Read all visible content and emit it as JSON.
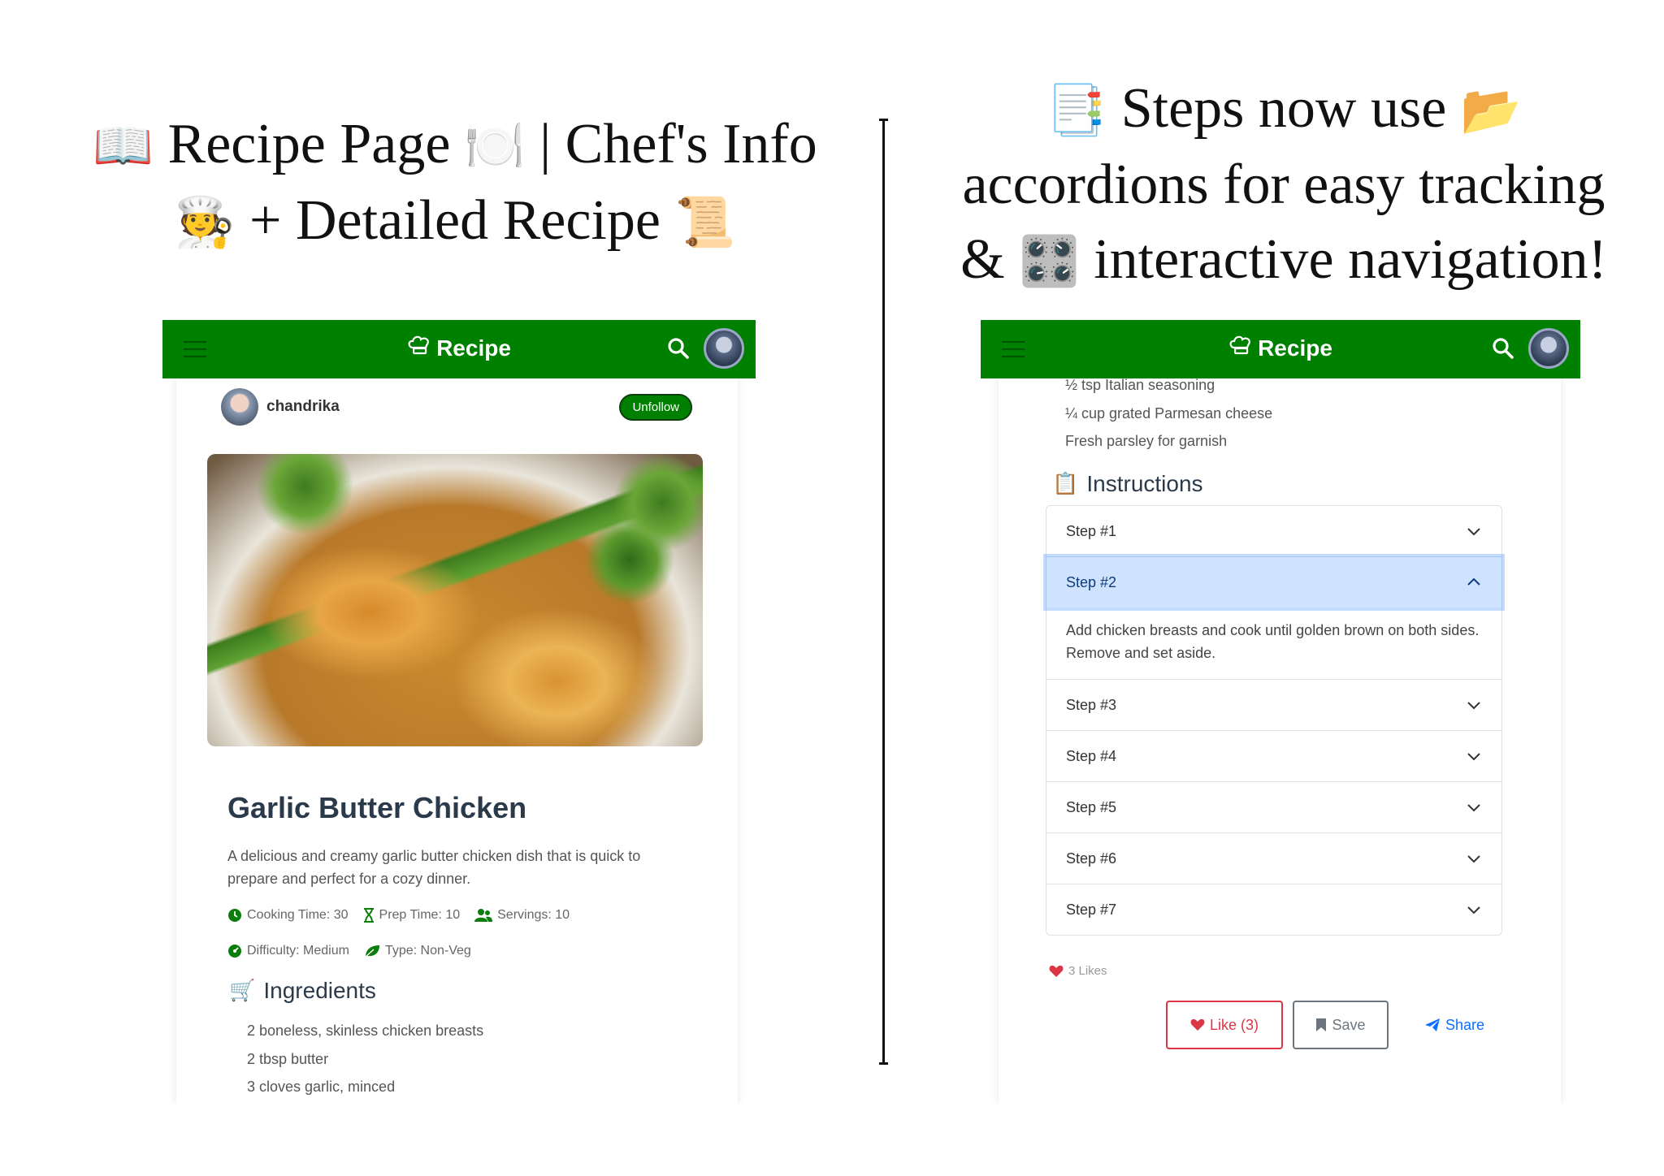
{
  "headline_left": {
    "line1_a": "Recipe Page",
    "line1_b": "| Chef's Info",
    "line2": "+ Detailed Recipe",
    "emoji_book": "📖",
    "emoji_plate": "🍽️",
    "emoji_chef": "🧑‍🍳",
    "emoji_scroll": "📜"
  },
  "headline_right": {
    "line1": "Steps now use",
    "line2": "accordions for easy tracking",
    "line3_a": "&",
    "line3_b": "interactive navigation!",
    "emoji_doc": "📑",
    "emoji_folder": "📂",
    "emoji_panel": "🎛️"
  },
  "navbar": {
    "brand": "Recipe",
    "brand_icon": "chef-hat-icon",
    "color": "#008000"
  },
  "author": {
    "name": "chandrika",
    "follow_label": "Unfollow"
  },
  "recipe": {
    "title": "Garlic Butter Chicken",
    "description": "A delicious and creamy garlic butter chicken dish that is quick to prepare and perfect for a cozy dinner.",
    "cooking_time": "Cooking Time: 30",
    "prep_time": "Prep Time: 10",
    "servings": "Servings: 10",
    "difficulty": "Difficulty: Medium",
    "type": "Type: Non-Veg"
  },
  "ingredients": {
    "heading": "Ingredients",
    "emoji": "🛒",
    "items_left": [
      "2 boneless, skinless chicken breasts",
      "2 tbsp butter",
      "3 cloves garlic, minced"
    ],
    "items_right": [
      "½ tsp Italian seasoning",
      "¼ cup grated Parmesan cheese",
      "Fresh parsley for garnish"
    ]
  },
  "instructions": {
    "heading": "Instructions",
    "emoji": "📋",
    "steps": [
      {
        "label": "Step #1",
        "open": false
      },
      {
        "label": "Step #2",
        "open": true,
        "body": "Add chicken breasts and cook until golden brown on both sides. Remove and set aside."
      },
      {
        "label": "Step #3",
        "open": false
      },
      {
        "label": "Step #4",
        "open": false
      },
      {
        "label": "Step #5",
        "open": false
      },
      {
        "label": "Step #6",
        "open": false
      },
      {
        "label": "Step #7",
        "open": false
      }
    ]
  },
  "engagement": {
    "likes_text": "3 Likes",
    "like_label": "Like (3)",
    "save_label": "Save",
    "share_label": "Share"
  }
}
